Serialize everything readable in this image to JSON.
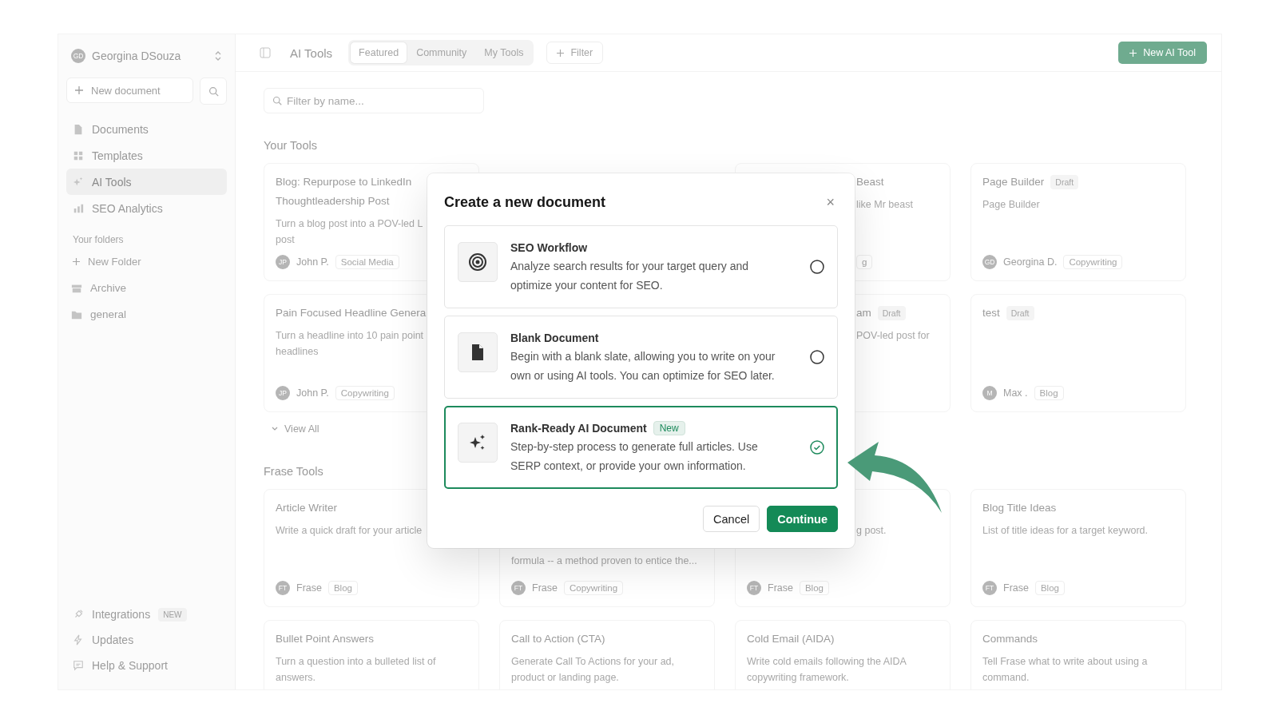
{
  "sidebar": {
    "user": {
      "initials": "GD",
      "name": "Georgina DSouza"
    },
    "new_document": "New document",
    "nav": [
      {
        "label": "Documents",
        "selected": false
      },
      {
        "label": "Templates",
        "selected": false
      },
      {
        "label": "AI Tools",
        "selected": true
      },
      {
        "label": "SEO Analytics",
        "selected": false
      }
    ],
    "folders_heading": "Your folders",
    "new_folder": "New Folder",
    "folders": [
      {
        "label": "Archive"
      },
      {
        "label": "general"
      }
    ],
    "bottom": [
      {
        "label": "Integrations",
        "badge": "NEW"
      },
      {
        "label": "Updates"
      },
      {
        "label": "Help & Support"
      }
    ]
  },
  "topbar": {
    "title": "AI Tools",
    "tabs": [
      {
        "label": "Featured",
        "selected": true
      },
      {
        "label": "Community",
        "selected": false
      },
      {
        "label": "My Tools",
        "selected": false
      }
    ],
    "filter": "Filter",
    "new_tool": "New AI Tool"
  },
  "search": {
    "placeholder": "Filter by name..."
  },
  "sections": [
    {
      "heading": "Your Tools",
      "footer_link": "View All",
      "cards": [
        {
          "kind": "full",
          "title": "Blog: Repurpose to LinkedIn\nThoughtleadership Post",
          "description": "Turn a blog post into a POV-led L\npost",
          "avatar": "JP",
          "author": "John P.",
          "tag": "Social Media"
        },
        {
          "kind": "covered"
        },
        {
          "kind": "cut-left",
          "title": "Beast",
          "description": "like Mr beast",
          "tag": "g"
        },
        {
          "kind": "full",
          "title": "Page Builder",
          "badge": "Draft",
          "description": "Page Builder",
          "avatar": "GD",
          "author": "Georgina D.",
          "tag": "Copywriting"
        },
        {
          "kind": "full",
          "title": "Pain Focused Headline Genera",
          "description": "Turn a headline into 10 pain point\nheadlines",
          "avatar": "JP",
          "author": "John P.",
          "tag": "Copywriting"
        },
        {
          "kind": "covered"
        },
        {
          "kind": "cut-left",
          "title": "am",
          "badge": "Draft",
          "description": "POV-led post for"
        },
        {
          "kind": "full",
          "title": "test",
          "badge": "Draft",
          "avatar": "M",
          "author": "Max .",
          "tag": "Blog"
        }
      ]
    },
    {
      "heading": "Frase Tools",
      "cards": [
        {
          "kind": "full",
          "title": "Article Writer",
          "description": "Write a quick draft for your article",
          "avatar": "FT",
          "author": "Frase",
          "tag": "Blog"
        },
        {
          "kind": "cut-below",
          "description": "formula -- a method proven to entice the...",
          "avatar": "FT",
          "author": "Frase",
          "tag": "Copywriting"
        },
        {
          "kind": "cut-left-top",
          "description": "g post.",
          "avatar": "FT",
          "author": "Frase",
          "tag": "Blog"
        },
        {
          "kind": "full",
          "title": "Blog Title Ideas",
          "description": "List of title ideas for a target keyword.",
          "avatar": "FT",
          "author": "Frase",
          "tag": "Blog"
        },
        {
          "kind": "full",
          "title": "Bullet Point Answers",
          "description": "Turn a question into a bulleted list of answers."
        },
        {
          "kind": "full",
          "title": "Call to Action (CTA)",
          "description": "Generate Call To Actions for your ad, product or landing page."
        },
        {
          "kind": "full",
          "title": "Cold Email (AIDA)",
          "description": "Write cold emails following the AIDA copywriting framework."
        },
        {
          "kind": "full",
          "title": "Commands",
          "description": "Tell Frase what to write about using a command."
        }
      ]
    }
  ],
  "dialog": {
    "title": "Create a new document",
    "close": "×",
    "options": [
      {
        "title": "SEO Workflow",
        "description": "Analyze search results for your target query and optimize your content for SEO.",
        "selected": false
      },
      {
        "title": "Blank Document",
        "description": "Begin with a blank slate, allowing you to write on your own or using AI tools. You can optimize for SEO later.",
        "selected": false
      },
      {
        "title": "Rank-Ready AI Document",
        "badge": "New",
        "description": "Step-by-step process to generate full articles. Use SERP context, or provide your own information.",
        "selected": true
      }
    ],
    "buttons": [
      {
        "label": "Cancel",
        "kind": "secondary"
      },
      {
        "label": "Continue",
        "kind": "primary"
      }
    ]
  }
}
